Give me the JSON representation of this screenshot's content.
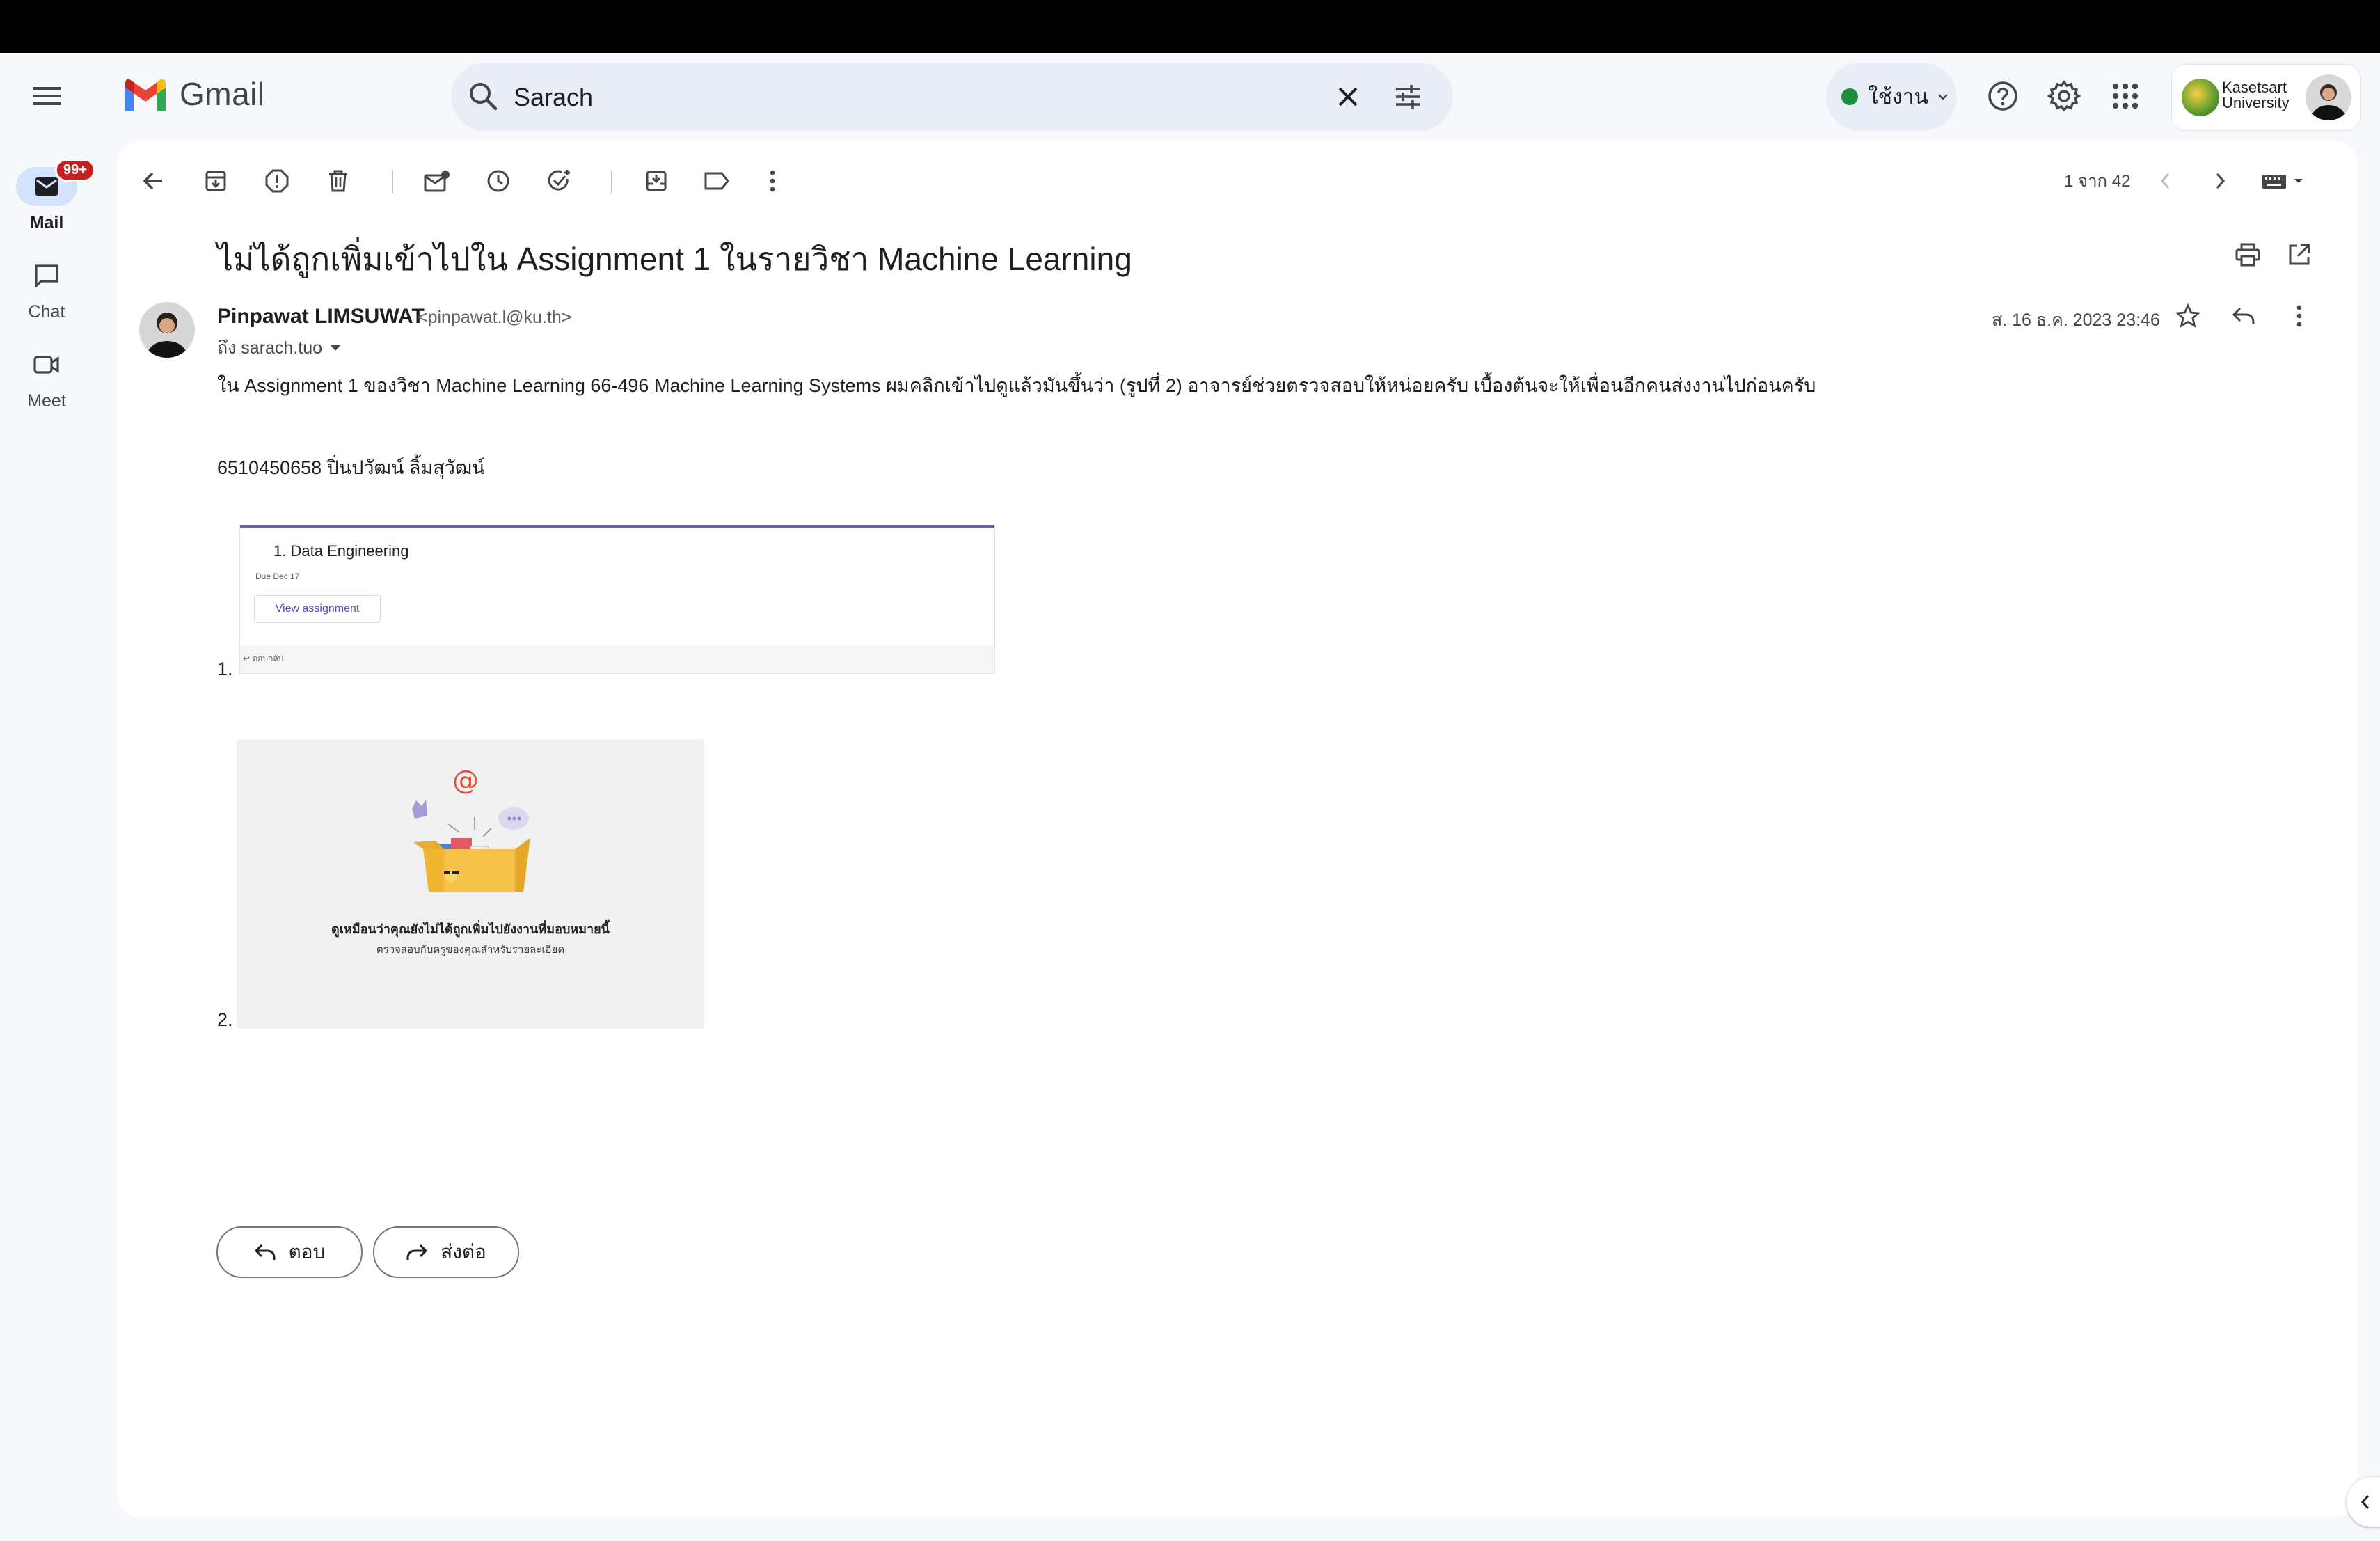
{
  "app": {
    "name": "Gmail"
  },
  "search": {
    "value": "Sarach"
  },
  "status": {
    "label": "ใช้งาน",
    "color": "#1e8e3e"
  },
  "account": {
    "org_line1": "Kasetsart",
    "org_line2": "University"
  },
  "rail": {
    "mail": {
      "label": "Mail",
      "badge": "99+"
    },
    "chat": {
      "label": "Chat"
    },
    "meet": {
      "label": "Meet"
    }
  },
  "toolbar": {
    "pager": "1 จาก 42"
  },
  "email": {
    "subject": "ไม่ได้ถูกเพิ่มเข้าไปใน Assignment 1 ในรายวิชา Machine Learning",
    "sender_name": "Pinpawat LIMSUWAT",
    "sender_email": "<pinpawat.l@ku.th>",
    "to": "ถึง sarach.tuo",
    "date": "ส. 16 ธ.ค. 2023 23:46",
    "body_line1": "ใน Assignment 1 ของวิชา Machine Learning 66-496 Machine Learning Systems ผมคลิกเข้าไปดูแล้วมันขึ้นว่า (รูปที่ 2) อาจารย์ช่วยตรวจสอบให้หน่อยครับ เบื้องต้นจะให้เพื่อนอีกคนส่งงานไปก่อนครับ",
    "body_line2": "6510450658 ปิ่นปวัฒน์ ลิ้มสุวัฒน์",
    "list_num_1": "1.",
    "list_num_2": "2.",
    "image1": {
      "title": "1. Data Engineering",
      "due": "Due Dec 17",
      "button": "View assignment",
      "footer": "↩ ตอบกลับ"
    },
    "image2": {
      "line1": "ดูเหมือนว่าคุณยังไม่ได้ถูกเพิ่มไปยังงานที่มอบหมายนี้",
      "line2": "ตรวจสอบกับครูของคุณสำหรับรายละเอียด"
    }
  },
  "actions": {
    "reply": "ตอบ",
    "forward": "ส่งต่อ"
  },
  "colors": {
    "accent": "#0b57d0",
    "surface": "#f6f8fc",
    "badge": "#c5221f"
  }
}
